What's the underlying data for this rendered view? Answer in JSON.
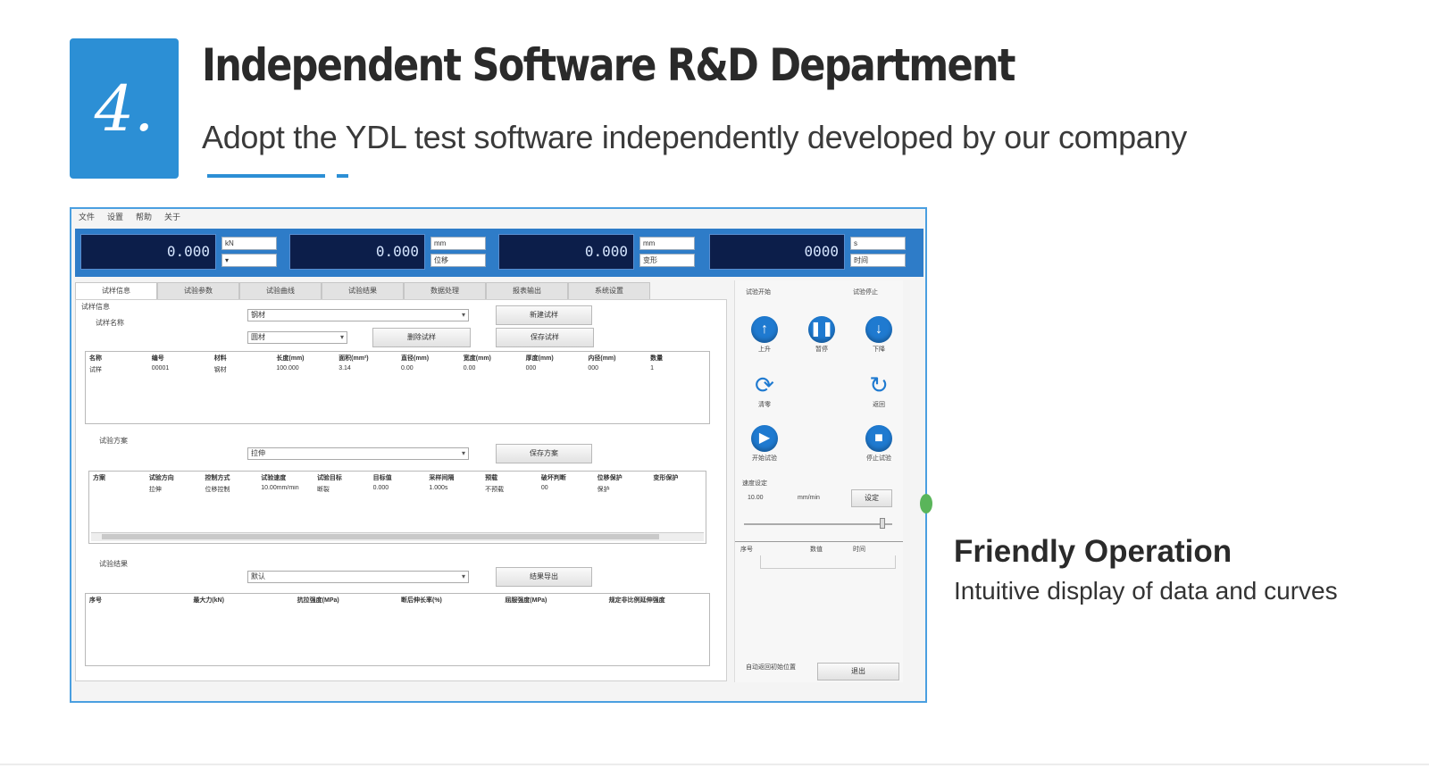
{
  "header": {
    "number": "4.",
    "title": "Independent Software R&D Department",
    "subtitle": "Adopt the YDL test software independently developed by our company"
  },
  "software": {
    "menu": [
      "文件",
      "设置",
      "帮助",
      "关于"
    ],
    "displays": [
      {
        "value": "0.000",
        "unit_top": "kN",
        "unit_bot": "▾"
      },
      {
        "value": "0.000",
        "unit_top": "mm",
        "unit_bot": "位移"
      },
      {
        "value": "0.000",
        "unit_top": "mm",
        "unit_bot": "变形"
      },
      {
        "value": "0000",
        "unit_top": "s",
        "unit_bot": "时间"
      }
    ],
    "tabs": [
      "试样信息",
      "试验参数",
      "试验曲线",
      "试验结果",
      "数据处理",
      "报表输出",
      "系统设置"
    ],
    "section1": {
      "label": "试样信息",
      "sub_label": "试样名称",
      "select1": "钢材",
      "select2": "圆材",
      "button_new": "新建试样",
      "button_del": "删除试样",
      "button_save": "保存试样",
      "columns": [
        "名称",
        "编号",
        "材料",
        "长度(mm)",
        "面积(mm²)",
        "直径(mm)",
        "宽度(mm)",
        "厚度(mm)",
        "内径(mm)",
        "数量"
      ],
      "row": [
        "试样",
        "00001",
        "钢材",
        "100.000",
        "3.14",
        "0.00",
        "0.00",
        "000",
        "000",
        "1"
      ]
    },
    "section2": {
      "label": "试验方案",
      "select": "拉伸",
      "button": "保存方案",
      "columns": [
        "方案",
        "试验方向",
        "控制方式",
        "试验速度",
        "试验目标",
        "目标值",
        "采样间隔",
        "预载",
        "破坏判断",
        "位移保护",
        "变形保护"
      ],
      "row": [
        "",
        "拉伸",
        "位移控制",
        "10.00mm/min",
        "断裂",
        "0.000",
        "1.000s",
        "不预载",
        "00",
        "保护",
        ""
      ]
    },
    "section3": {
      "label": "试验结果",
      "select": "默认",
      "button": "结果导出",
      "columns": [
        "序号",
        "最大力(kN)",
        "抗拉强度(MPa)",
        "断后伸长率(%)",
        "屈服强度(MPa)",
        "规定非比例延伸强度"
      ]
    },
    "controls": {
      "label_left": "试验开始",
      "label_right": "试验停止",
      "up": "上升",
      "pause": "暂停",
      "down": "下降",
      "reset": "清零",
      "return": "返回",
      "start_test": "开始试验",
      "stop_test": "停止试验",
      "speed_label": "速度设定",
      "speed_unit": "mm/min",
      "speed_value": "10.00",
      "speed_button": "设定",
      "table_cols": [
        "序号",
        "数值",
        "时间"
      ],
      "auto_label": "自动返回初始位置",
      "exit_button": "退出"
    }
  },
  "feature": {
    "title": "Friendly Operation",
    "description": "Intuitive display of data and curves"
  },
  "colors": {
    "accent": "#2c8fd5",
    "display_bg": "#0c1e4a",
    "control_blue": "#1f7ad0"
  }
}
